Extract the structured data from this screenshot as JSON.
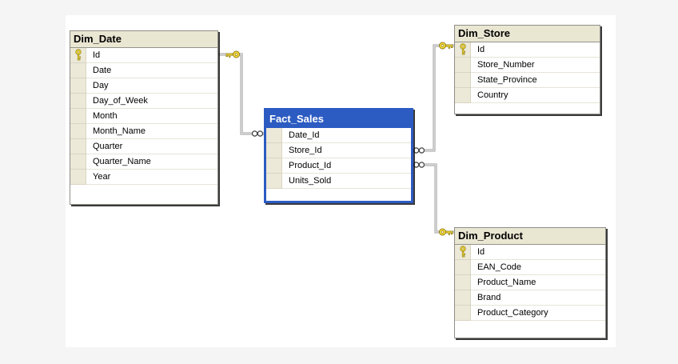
{
  "page": {
    "background_color": "#f5f5f5",
    "canvas_color": "#ffffff"
  },
  "diagram": {
    "tables": [
      {
        "name": "Dim_Date",
        "selected": false,
        "columns": [
          {
            "name": "Id",
            "pk": true
          },
          {
            "name": "Date",
            "pk": false
          },
          {
            "name": "Day",
            "pk": false
          },
          {
            "name": "Day_of_Week",
            "pk": false
          },
          {
            "name": "Month",
            "pk": false
          },
          {
            "name": "Month_Name",
            "pk": false
          },
          {
            "name": "Quarter",
            "pk": false
          },
          {
            "name": "Quarter_Name",
            "pk": false
          },
          {
            "name": "Year",
            "pk": false
          }
        ]
      },
      {
        "name": "Fact_Sales",
        "selected": true,
        "columns": [
          {
            "name": "Date_Id",
            "pk": false
          },
          {
            "name": "Store_Id",
            "pk": false
          },
          {
            "name": "Product_Id",
            "pk": false
          },
          {
            "name": "Units_Sold",
            "pk": false
          }
        ]
      },
      {
        "name": "Dim_Store",
        "selected": false,
        "columns": [
          {
            "name": "Id",
            "pk": true
          },
          {
            "name": "Store_Number",
            "pk": false
          },
          {
            "name": "State_Province",
            "pk": false
          },
          {
            "name": "Country",
            "pk": false
          }
        ]
      },
      {
        "name": "Dim_Product",
        "selected": false,
        "columns": [
          {
            "name": "Id",
            "pk": true
          },
          {
            "name": "EAN_Code",
            "pk": false
          },
          {
            "name": "Product_Name",
            "pk": false
          },
          {
            "name": "Brand",
            "pk": false
          },
          {
            "name": "Product_Category",
            "pk": false
          }
        ]
      }
    ],
    "relationships": [
      {
        "from_table": "Fact_Sales",
        "from_column": "Date_Id",
        "from_cardinality": "many",
        "to_table": "Dim_Date",
        "to_column": "Id",
        "to_cardinality": "one"
      },
      {
        "from_table": "Fact_Sales",
        "from_column": "Store_Id",
        "from_cardinality": "many",
        "to_table": "Dim_Store",
        "to_column": "Id",
        "to_cardinality": "one"
      },
      {
        "from_table": "Fact_Sales",
        "from_column": "Product_Id",
        "from_cardinality": "many",
        "to_table": "Dim_Product",
        "to_column": "Id",
        "to_cardinality": "one"
      }
    ],
    "icons": {
      "primary_key": "gold-key-icon",
      "one_side": "gold-key-icon",
      "many_side": "infinity-icon"
    },
    "colors": {
      "selected_header_bg": "#2c5bc2",
      "selected_border": "#2c5bc2",
      "header_bg": "#e9e6d2",
      "row_selector_bg": "#ece9d8",
      "table_border": "#8f8f88",
      "connector_line": "#9a9a9a",
      "key_gold": "#ffe23e",
      "shadow": "#1a1a1a"
    }
  }
}
